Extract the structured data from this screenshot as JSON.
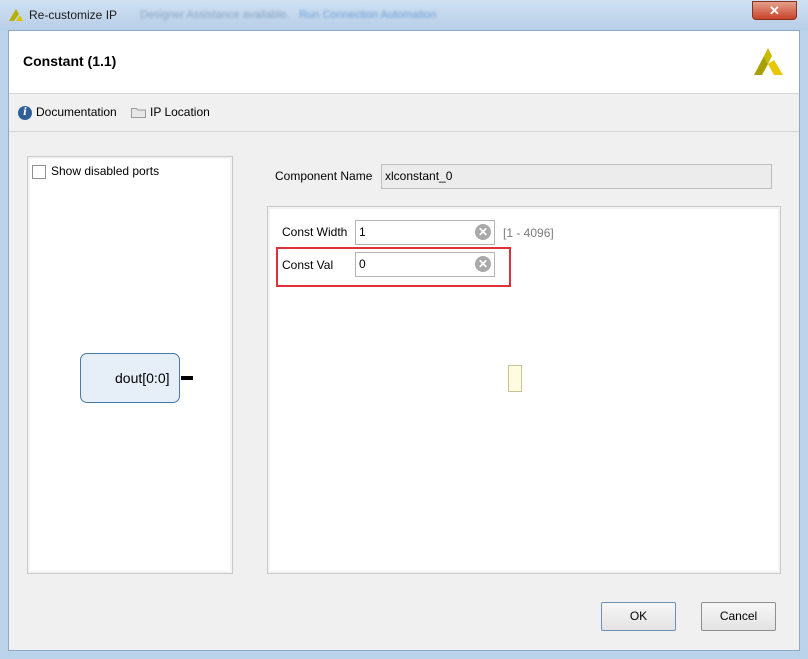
{
  "window": {
    "title": "Re-customize IP",
    "background_hint": "Designer Assistance available.",
    "background_hint_link": "Run Connection Automation",
    "close_glyph": "✕"
  },
  "header": {
    "dialog_title": "Constant (1.1)",
    "logo_icon": "vivado-logo-icon"
  },
  "toolbar": {
    "documentation_label": "Documentation",
    "ip_location_label": "IP Location",
    "info_glyph": "i"
  },
  "left_panel": {
    "show_disabled_ports_label": "Show disabled ports",
    "show_disabled_ports_checked": false,
    "block_port_label": "dout[0:0]"
  },
  "component": {
    "name_label": "Component Name",
    "name_value": "xlconstant_0"
  },
  "params": {
    "const_width": {
      "label": "Const Width",
      "value": "1",
      "range": "[1 - 4096]"
    },
    "const_val": {
      "label": "Const Val",
      "value": "0"
    },
    "clear_glyph": "✕"
  },
  "buttons": {
    "ok": "OK",
    "cancel": "Cancel"
  },
  "colors": {
    "highlight": "#e0303a",
    "accent": "#2f5f99"
  }
}
